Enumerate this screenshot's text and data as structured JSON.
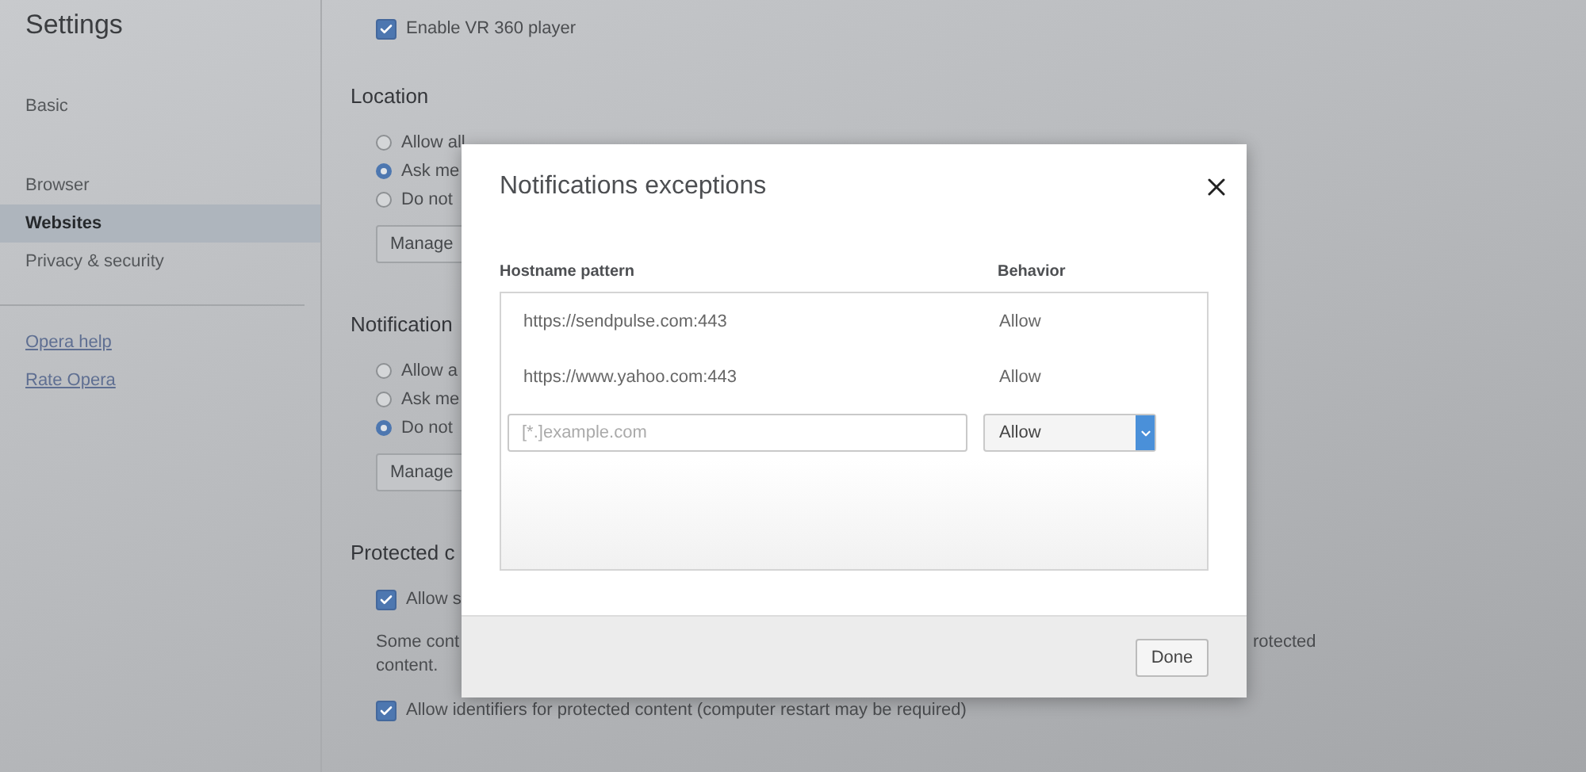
{
  "sidebar": {
    "title": "Settings",
    "items": [
      {
        "label": "Basic",
        "selected": false
      },
      {
        "label": "Browser",
        "selected": false
      },
      {
        "label": "Websites",
        "selected": true
      },
      {
        "label": "Privacy & security",
        "selected": false
      }
    ],
    "links": [
      "Opera help",
      "Rate Opera"
    ]
  },
  "content": [
    {
      "kind": "checkbox",
      "label": "Enable VR 360 player",
      "checked": true
    },
    {
      "kind": "heading",
      "label": "Location"
    },
    {
      "kind": "radio",
      "label": "Allow all",
      "selected": false
    },
    {
      "kind": "radio",
      "label": "Ask me",
      "selected": true
    },
    {
      "kind": "radio",
      "label": "Do not",
      "selected": false
    },
    {
      "kind": "button",
      "label": "Manage"
    },
    {
      "kind": "heading",
      "label": "Notification"
    },
    {
      "kind": "radio",
      "label": "Allow a",
      "selected": false
    },
    {
      "kind": "radio",
      "label": "Ask me",
      "selected": false
    },
    {
      "kind": "radio",
      "label": "Do not",
      "selected": true
    },
    {
      "kind": "button",
      "label": "Manage"
    },
    {
      "kind": "heading",
      "label": "Protected c"
    },
    {
      "kind": "checkbox",
      "label": "Allow s",
      "checked": true
    },
    {
      "kind": "note",
      "parts": [
        "Some cont",
        "rotected"
      ],
      "continuation": "content."
    },
    {
      "kind": "checkbox",
      "label": "Allow identifiers for protected content (computer restart may be required)",
      "checked": true
    }
  ],
  "dialog": {
    "title": "Notifications exceptions",
    "columns": [
      "Hostname pattern",
      "Behavior"
    ],
    "rows": [
      {
        "hostname": "https://sendpulse.com:443",
        "behavior": "Allow"
      },
      {
        "hostname": "https://www.yahoo.com:443",
        "behavior": "Allow"
      }
    ],
    "new_row": {
      "placeholder": "[*.]example.com",
      "behavior": "Allow"
    },
    "button": "Done"
  }
}
